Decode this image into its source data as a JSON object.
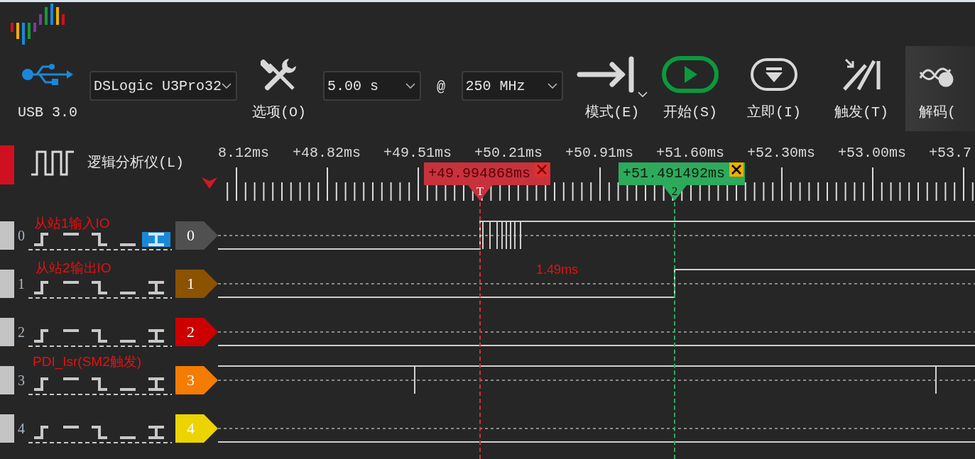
{
  "toolbar": [
    {
      "kind": "usb",
      "label": "USB 3.0"
    },
    {
      "kind": "device",
      "value": "DSLogic U3Pro32"
    },
    {
      "kind": "options",
      "label": "选项(O)"
    },
    {
      "kind": "duration",
      "value": "5.00 s"
    },
    {
      "kind": "at",
      "label": "@"
    },
    {
      "kind": "frequency",
      "value": "250 MHz"
    },
    {
      "kind": "mode",
      "label": "模式(E)"
    },
    {
      "kind": "start",
      "label": "开始(S)"
    },
    {
      "kind": "instant",
      "label": "立即(I)"
    },
    {
      "kind": "trigger",
      "label": "触发(T)"
    },
    {
      "kind": "decode",
      "label": "解码("
    }
  ],
  "group": {
    "title": "逻辑分析仪(L)"
  },
  "ruler": {
    "labels": [
      "8.12ms",
      "+48.82ms",
      "+49.51ms",
      "+50.21ms",
      "+50.91ms",
      "+51.60ms",
      "+52.30ms",
      "+53.00ms",
      "+53.7"
    ]
  },
  "cursors": [
    {
      "label": "T",
      "time": "+49.994868ms",
      "color": "#c8323c",
      "close_highlighted": false
    },
    {
      "label": "2",
      "time": "+51.491492ms",
      "color": "#2eaa5c",
      "close_highlighted": true
    }
  ],
  "channels": [
    {
      "index": "0",
      "badge": "0",
      "color": "#505050",
      "triggers": [
        {
          "kind": "rise",
          "selected": false
        },
        {
          "kind": "high",
          "selected": false
        },
        {
          "kind": "fall",
          "selected": false
        },
        {
          "kind": "low",
          "selected": false
        },
        {
          "kind": "edge",
          "selected": true
        }
      ]
    },
    {
      "index": "1",
      "badge": "1",
      "color": "#8b5200",
      "triggers": [
        {
          "kind": "rise",
          "selected": false
        },
        {
          "kind": "high",
          "selected": false
        },
        {
          "kind": "fall",
          "selected": false
        },
        {
          "kind": "low",
          "selected": false
        },
        {
          "kind": "edge",
          "selected": false
        }
      ]
    },
    {
      "index": "2",
      "badge": "2",
      "color": "#cc0000",
      "triggers": [
        {
          "kind": "rise",
          "selected": false
        },
        {
          "kind": "high",
          "selected": false
        },
        {
          "kind": "fall",
          "selected": false
        },
        {
          "kind": "low",
          "selected": false
        },
        {
          "kind": "edge",
          "selected": false
        }
      ]
    },
    {
      "index": "3",
      "badge": "3",
      "color": "#f47c00",
      "triggers": [
        {
          "kind": "rise",
          "selected": false
        },
        {
          "kind": "high",
          "selected": false
        },
        {
          "kind": "fall",
          "selected": false
        },
        {
          "kind": "low",
          "selected": false
        },
        {
          "kind": "edge",
          "selected": false
        }
      ]
    },
    {
      "index": "4",
      "badge": "4",
      "color": "#ecd400",
      "triggers": [
        {
          "kind": "rise",
          "selected": false
        },
        {
          "kind": "high",
          "selected": false
        },
        {
          "kind": "fall",
          "selected": false
        },
        {
          "kind": "low",
          "selected": false
        },
        {
          "kind": "edge",
          "selected": false
        }
      ]
    }
  ],
  "annotations": [
    {
      "text": "从站1输入IO"
    },
    {
      "text": "从站2输出IO"
    },
    {
      "text": "1.49ms"
    },
    {
      "text": "PDI_Isr(SM2触发)"
    }
  ]
}
